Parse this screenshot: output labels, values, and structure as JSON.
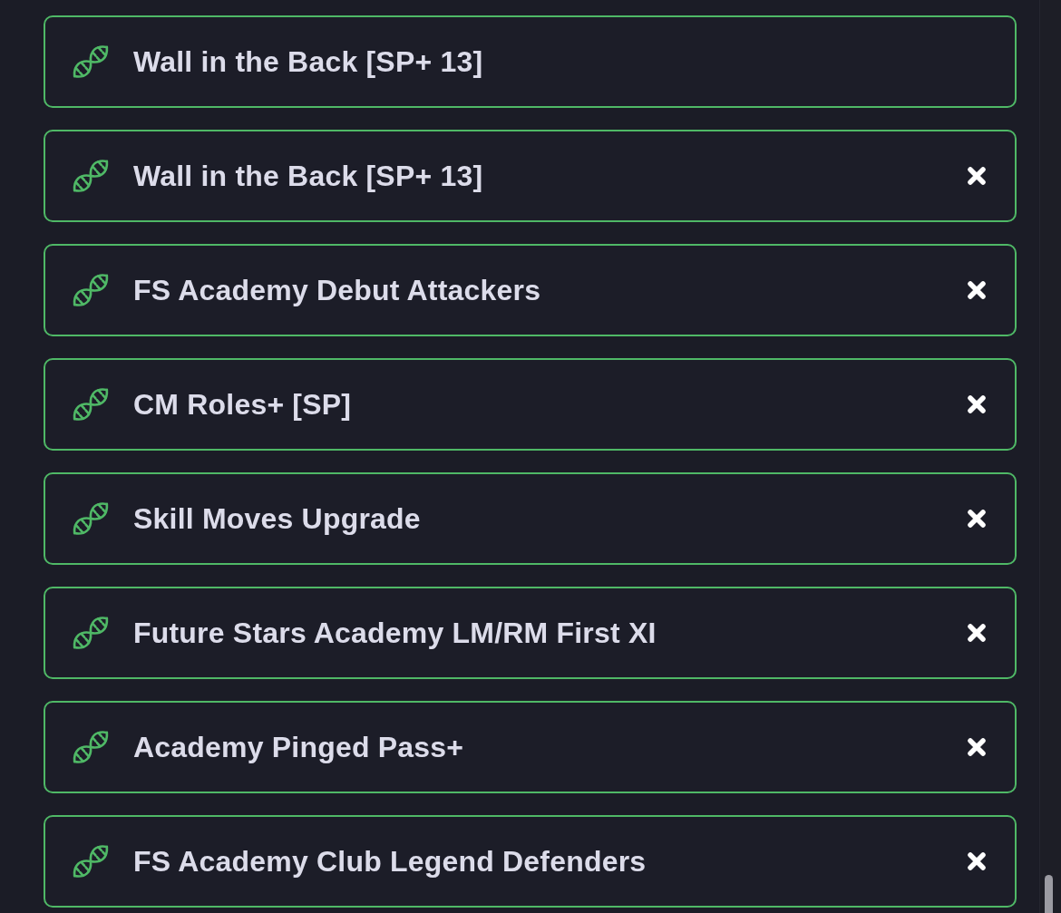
{
  "items": [
    {
      "title": "Wall in the Back [SP+ 13]",
      "removable": false
    },
    {
      "title": "Wall in the Back [SP+ 13]",
      "removable": true
    },
    {
      "title": "FS Academy Debut Attackers",
      "removable": true
    },
    {
      "title": "CM Roles+ [SP]",
      "removable": true
    },
    {
      "title": "Skill Moves Upgrade",
      "removable": true
    },
    {
      "title": "Future Stars Academy LM/RM First XI",
      "removable": true
    },
    {
      "title": "Academy Pinged Pass+",
      "removable": true
    },
    {
      "title": "FS Academy Club Legend Defenders",
      "removable": true
    }
  ]
}
